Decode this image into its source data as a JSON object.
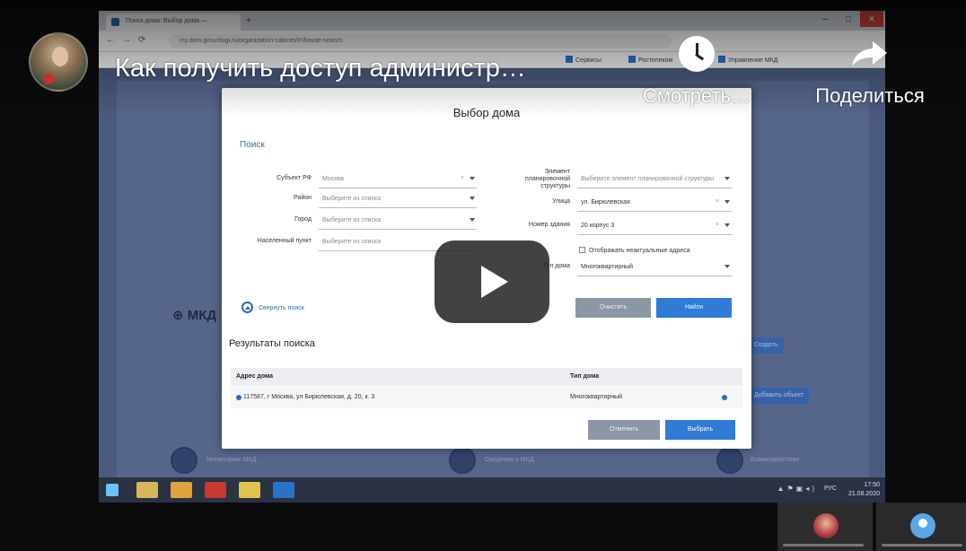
{
  "youtube": {
    "video_title": "Как получить доступ администр…",
    "watch_later_label": "Смотреть…",
    "share_label": "Поделиться"
  },
  "browser": {
    "tab_title": "Поиск дома: Выбор дома —",
    "new_tab": "+",
    "url": "my.dom.gosuslugi.ru/organization-cabinet/#!/house-search",
    "bookmarks": [
      "Сервисы",
      "Ростелеком",
      "Управление МКД"
    ]
  },
  "site": {
    "mkd_label": "МКД",
    "ghost_buttons": [
      "Создать",
      "Добавить объект"
    ],
    "services": [
      "Мониторинг МКД",
      "Сведения о МКД",
      "Взаимодействие"
    ]
  },
  "modal": {
    "title": "Выбор дома",
    "section_search": "Поиск",
    "fields": {
      "subject": {
        "label": "Субъект РФ",
        "value": "Москва"
      },
      "district": {
        "label": "Район",
        "value": "Выберите из списка"
      },
      "city": {
        "label": "Город",
        "value": "Выберите из списка"
      },
      "settlement": {
        "label": "Населенный пункт",
        "value": "Выберите из списка"
      },
      "planning": {
        "label": "Элемент планировочной структуры",
        "value": "Выберите элемент планировочной структуры"
      },
      "street": {
        "label": "Улица",
        "value": "ул. Бирюлевская"
      },
      "house_number": {
        "label": "Номер здания",
        "value": "20 корпус 3"
      },
      "house_type": {
        "label": "Тип дома",
        "value": "Многоквартирный"
      }
    },
    "inexact_label": "Отображать неактуальные адреса",
    "collapse_label": "Свернуть поиск",
    "clear_label": "Очистить",
    "find_label": "Найти",
    "results_title": "Результаты поиска",
    "columns": [
      "Адрес дома",
      "Тип дома"
    ],
    "rows": [
      {
        "address": "117587, г Москва, ул Бирюлевская, д. 20, к. 3",
        "type": "Многоквартирный"
      }
    ],
    "cancel_label": "Отменить",
    "select_label": "Выбрать"
  },
  "taskbar": {
    "lang": "РУС",
    "time": "17:50",
    "date": "21.08.2020"
  }
}
